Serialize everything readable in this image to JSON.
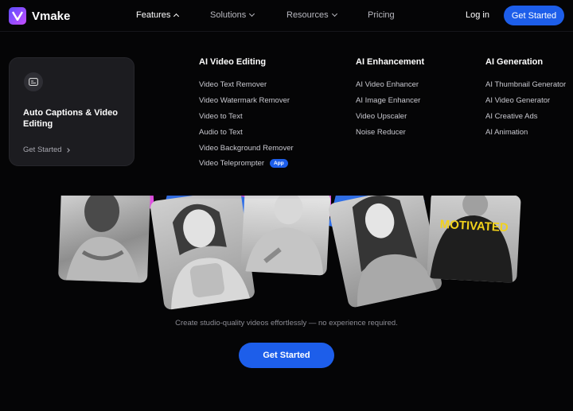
{
  "nav": {
    "brand": "Vmake",
    "items": [
      {
        "label": "Features"
      },
      {
        "label": "Solutions"
      },
      {
        "label": "Resources"
      },
      {
        "label": "Pricing"
      }
    ],
    "login": "Log in",
    "cta": "Get Started"
  },
  "dropdown": {
    "feature_card": {
      "icon": "captions-icon",
      "title": "Auto Captions & Video Editing",
      "link": "Get Started"
    },
    "columns": [
      {
        "title": "AI Video Editing",
        "items": [
          {
            "label": "Video Text Remover"
          },
          {
            "label": "Video Watermark Remover"
          },
          {
            "label": "Video to Text"
          },
          {
            "label": "Audio to Text"
          },
          {
            "label": "Video Background Remover"
          },
          {
            "label": "Video Teleprompter",
            "badge": "App"
          }
        ]
      },
      {
        "title": "AI Enhancement",
        "items": [
          {
            "label": "AI Video Enhancer"
          },
          {
            "label": "AI Image Enhancer"
          },
          {
            "label": "Video Upscaler"
          },
          {
            "label": "Noise Reducer"
          }
        ]
      },
      {
        "title": "AI Generation",
        "items": [
          {
            "label": "AI Thumbnail Generator"
          },
          {
            "label": "AI Video Generator"
          },
          {
            "label": "AI Creative Ads"
          },
          {
            "label": "AI Animation"
          }
        ]
      }
    ]
  },
  "hero": {
    "shirt_text": "MOTIVATED",
    "tagline": "Create studio-quality videos effortlessly — no experience required.",
    "cta": "Get Started"
  },
  "colors": {
    "accent": "#1d5eea",
    "magenta": "#e04fe0",
    "blue": "#2f6fe8",
    "yellow": "#f2d21b",
    "background": "#050506"
  }
}
